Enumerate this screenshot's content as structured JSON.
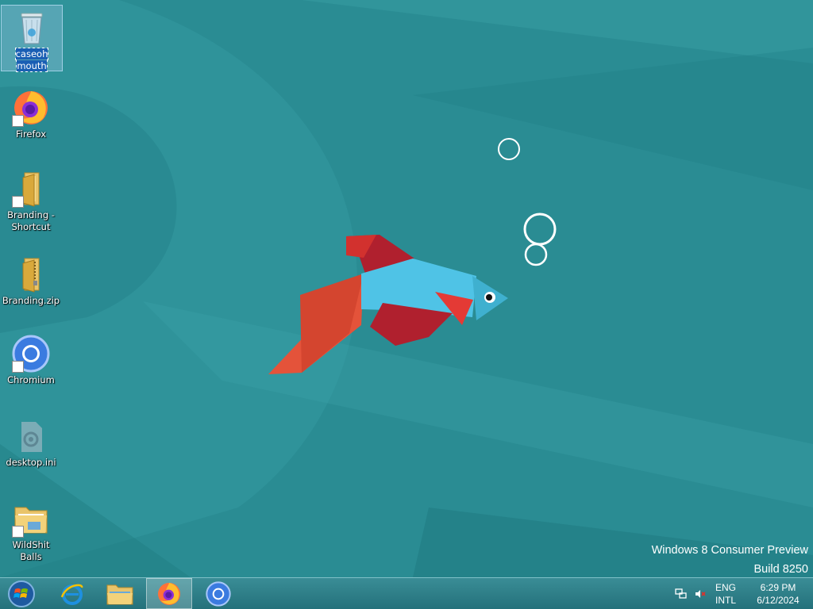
{
  "desktop": {
    "icons": [
      {
        "label": "caseoh mouth",
        "icon": "recycle-bin-icon",
        "selected": true
      },
      {
        "label": "Firefox",
        "icon": "firefox-icon"
      },
      {
        "label": "Branding - Shortcut",
        "icon": "folder-shortcut-icon"
      },
      {
        "label": "Branding.zip",
        "icon": "zip-folder-icon"
      },
      {
        "label": "Chromium",
        "icon": "chromium-icon"
      },
      {
        "label": "desktop.ini",
        "icon": "settings-file-icon"
      },
      {
        "label": "WildShit Balls",
        "icon": "folder-shortcut-icon"
      }
    ],
    "watermark": {
      "line1": "Windows 8 Consumer Preview",
      "line2": "Build 8250"
    }
  },
  "taskbar": {
    "buttons": [
      {
        "name": "start-button",
        "icon": "windows-orb-icon"
      },
      {
        "name": "internet-explorer",
        "icon": "ie-icon"
      },
      {
        "name": "file-explorer",
        "icon": "folder-icon"
      },
      {
        "name": "firefox",
        "icon": "firefox-icon",
        "active": true
      },
      {
        "name": "chromium",
        "icon": "chromium-icon"
      }
    ],
    "tray": {
      "lang_top": "ENG",
      "lang_bottom": "INTL",
      "time": "6:29 PM",
      "date": "6/12/2024"
    }
  },
  "colors": {
    "desktop_bg": "#2a8c93",
    "taskbar_bg": "#2e7f88",
    "fish_body": "#4fc3e6",
    "fish_fin_red": "#b0202e",
    "fish_tail_orange": "#e4533a"
  }
}
